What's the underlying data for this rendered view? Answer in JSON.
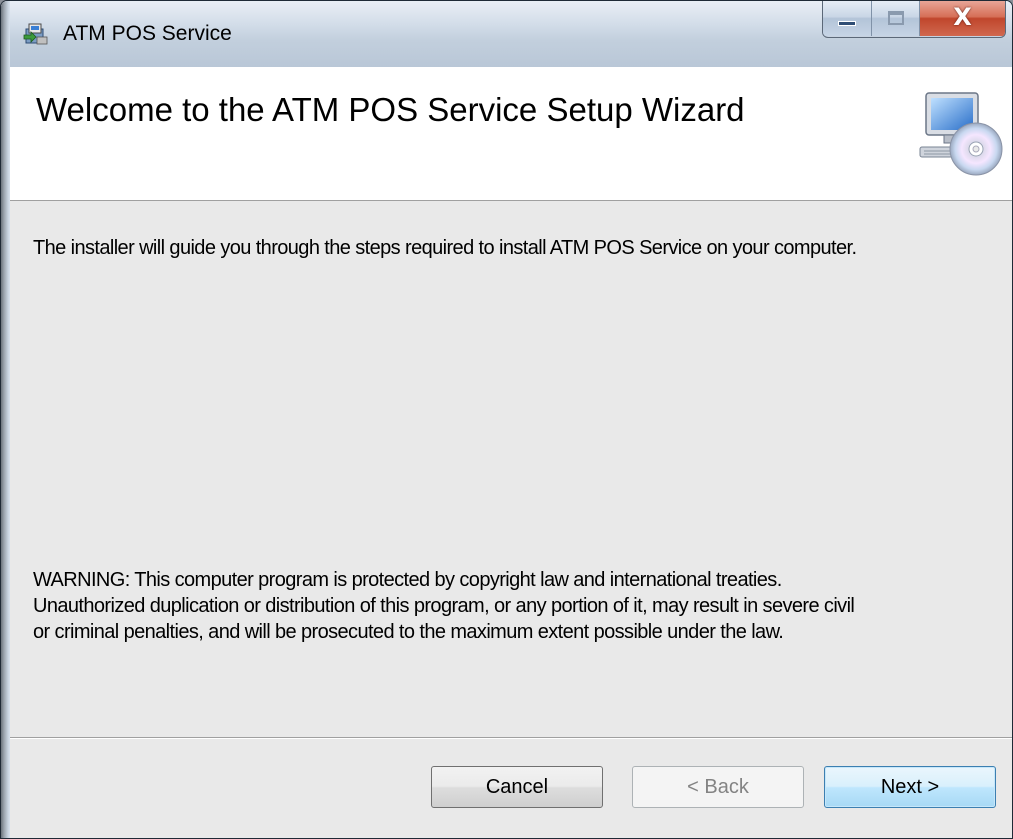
{
  "window": {
    "title": "ATM POS Service",
    "icons": {
      "app": "installer-package-icon",
      "minimize": "minimize-icon",
      "maximize": "maximize-icon",
      "close": "close-icon"
    },
    "close_glyph": "X"
  },
  "header": {
    "title": "Welcome to the ATM POS Service Setup Wizard",
    "icon": "computer-cd-setup-icon"
  },
  "content": {
    "intro": "The installer will guide you through the steps required to install ATM POS Service on your computer.",
    "warning_lines": [
      "WARNING: This computer program is protected by copyright law and international treaties.",
      "Unauthorized duplication or distribution of this program, or any portion of it, may result in severe civil",
      "or criminal penalties, and will be prosecuted to the maximum extent possible under the law."
    ]
  },
  "footer": {
    "cancel_label": "Cancel",
    "back_label": "< Back",
    "next_label": "Next >"
  },
  "colors": {
    "header_bg": "#ffffff",
    "content_bg": "#e9e9e9",
    "close_button": "#c0462c",
    "next_button_border": "#3c7fb1"
  }
}
